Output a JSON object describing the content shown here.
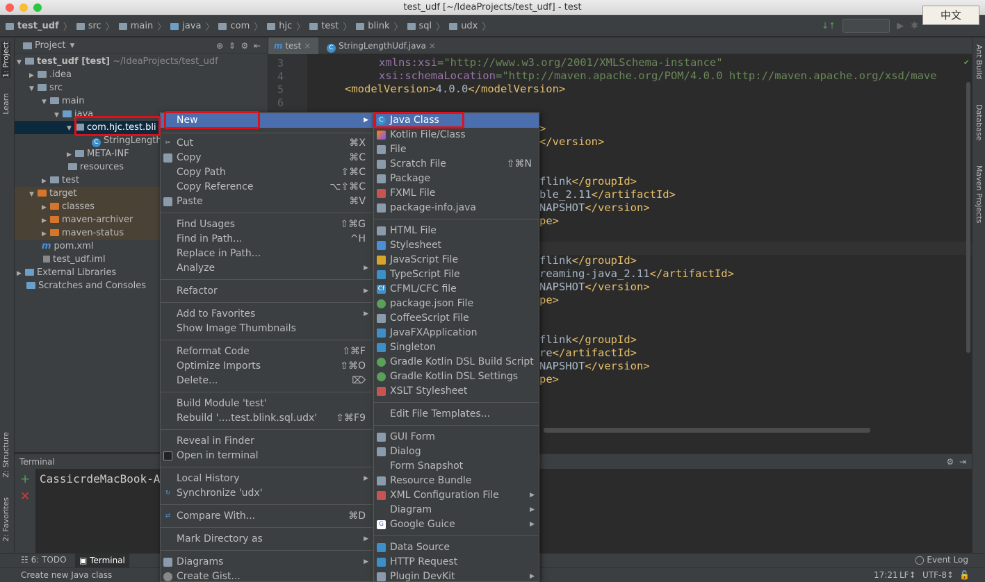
{
  "window": {
    "title": "test_udf [~/IdeaProjects/test_udf] - test",
    "ime_label": "中文"
  },
  "breadcrumbs": [
    "test_udf",
    "src",
    "main",
    "java",
    "com",
    "hjc",
    "test",
    "blink",
    "sql",
    "udx"
  ],
  "left_tabs": {
    "project": "1: Project",
    "learn": "Learn",
    "structure": "Z: Structure",
    "favorites": "2: Favorites"
  },
  "right_tabs": {
    "ant": "Ant Build",
    "database": "Database",
    "maven": "Maven Projects"
  },
  "project_panel": {
    "title": "Project",
    "tree": [
      {
        "label": "test_udf [test]",
        "suffix": "~/IdeaProjects/test_udf"
      },
      {
        "label": ".idea"
      },
      {
        "label": "src"
      },
      {
        "label": "main"
      },
      {
        "label": "java"
      },
      {
        "label": "com.hjc.test.bli"
      },
      {
        "label": "StringLength"
      },
      {
        "label": "META-INF"
      },
      {
        "label": "resources"
      },
      {
        "label": "test"
      },
      {
        "label": "target"
      },
      {
        "label": "classes"
      },
      {
        "label": "maven-archiver"
      },
      {
        "label": "maven-status"
      },
      {
        "label": "pom.xml"
      },
      {
        "label": "test_udf.iml"
      },
      {
        "label": "External Libraries"
      },
      {
        "label": "Scratches and Consoles"
      }
    ]
  },
  "editor": {
    "tabs": [
      {
        "label": "test"
      },
      {
        "label": "StringLengthUdf.java"
      }
    ],
    "line_numbers": [
      "3",
      "4",
      "5",
      "6"
    ],
    "lines": {
      "l3a": "xmlns",
      "l3b": ":xsi",
      "l3c": "=\"http://www.w3.org/2001/XMLSchema-instance\"",
      "l4a": "xsi:schemaLocation",
      "l4b": "=\"http://maven.apache.org/POM/4.0.0 http://maven.apache.org/xsd/mave",
      "l5a": "<modelVersion>",
      "l5b": "4.0.0",
      "l5c": "</modelVersion>",
      "r1": ">",
      "r2": "</version>",
      "r3a": "flink",
      "r3b": "</groupId>",
      "r4a": "ble_2.11",
      "r4b": "</artifactId>",
      "r5a": "NAPSHOT",
      "r5b": "</version>",
      "r6": "pe>",
      "r7a": "flink",
      "r7b": "</groupId>",
      "r8a": "reaming-java_2.11",
      "r8b": "</artifactId>",
      "r9a": "NAPSHOT",
      "r9b": "</version>",
      "r10": "pe>",
      "r11a": "flink",
      "r11b": "</groupId>",
      "r12a": "re",
      "r12b": "</artifactId>",
      "r13a": "NAPSHOT",
      "r13b": "</version>",
      "r14": "pe>"
    }
  },
  "terminal": {
    "title": "Terminal",
    "prompt": "CassicrdeMacBook-A"
  },
  "bottom_tabs": {
    "todo": "6: TODO",
    "terminal": "Terminal",
    "event_log": "Event Log"
  },
  "status": {
    "message": "Create new Java class",
    "position": "17:21",
    "line_sep": "LF↕",
    "encoding": "UTF-8↕"
  },
  "context_menu": {
    "items": [
      {
        "label": "New",
        "shortcut": ""
      },
      {
        "label": "Cut",
        "shortcut": "⌘X"
      },
      {
        "label": "Copy",
        "shortcut": "⌘C"
      },
      {
        "label": "Copy Path",
        "shortcut": "⇧⌘C"
      },
      {
        "label": "Copy Reference",
        "shortcut": "⌥⇧⌘C"
      },
      {
        "label": "Paste",
        "shortcut": "⌘V"
      },
      {
        "label": "Find Usages",
        "shortcut": "⇧⌘G"
      },
      {
        "label": "Find in Path...",
        "shortcut": "^H"
      },
      {
        "label": "Replace in Path...",
        "shortcut": ""
      },
      {
        "label": "Analyze",
        "shortcut": ""
      },
      {
        "label": "Refactor",
        "shortcut": ""
      },
      {
        "label": "Add to Favorites",
        "shortcut": ""
      },
      {
        "label": "Show Image Thumbnails",
        "shortcut": ""
      },
      {
        "label": "Reformat Code",
        "shortcut": "⇧⌘F"
      },
      {
        "label": "Optimize Imports",
        "shortcut": "⇧⌘O"
      },
      {
        "label": "Delete...",
        "shortcut": "⌦"
      },
      {
        "label": "Build Module 'test'",
        "shortcut": ""
      },
      {
        "label": "Rebuild '....test.blink.sql.udx'",
        "shortcut": "⇧⌘F9"
      },
      {
        "label": "Reveal in Finder",
        "shortcut": ""
      },
      {
        "label": "Open in terminal",
        "shortcut": ""
      },
      {
        "label": "Local History",
        "shortcut": ""
      },
      {
        "label": "Synchronize 'udx'",
        "shortcut": ""
      },
      {
        "label": "Compare With...",
        "shortcut": "⌘D"
      },
      {
        "label": "Mark Directory as",
        "shortcut": ""
      },
      {
        "label": "Diagrams",
        "shortcut": ""
      },
      {
        "label": "Create Gist...",
        "shortcut": ""
      }
    ]
  },
  "new_submenu": {
    "items": [
      {
        "label": "Java Class",
        "shortcut": ""
      },
      {
        "label": "Kotlin File/Class",
        "shortcut": ""
      },
      {
        "label": "File",
        "shortcut": ""
      },
      {
        "label": "Scratch File",
        "shortcut": "⇧⌘N"
      },
      {
        "label": "Package",
        "shortcut": ""
      },
      {
        "label": "FXML File",
        "shortcut": ""
      },
      {
        "label": "package-info.java",
        "shortcut": ""
      },
      {
        "label": "HTML File",
        "shortcut": ""
      },
      {
        "label": "Stylesheet",
        "shortcut": ""
      },
      {
        "label": "JavaScript File",
        "shortcut": ""
      },
      {
        "label": "TypeScript File",
        "shortcut": ""
      },
      {
        "label": "CFML/CFC file",
        "shortcut": ""
      },
      {
        "label": "package.json File",
        "shortcut": ""
      },
      {
        "label": "CoffeeScript File",
        "shortcut": ""
      },
      {
        "label": "JavaFXApplication",
        "shortcut": ""
      },
      {
        "label": "Singleton",
        "shortcut": ""
      },
      {
        "label": "Gradle Kotlin DSL Build Script",
        "shortcut": ""
      },
      {
        "label": "Gradle Kotlin DSL Settings",
        "shortcut": ""
      },
      {
        "label": "XSLT Stylesheet",
        "shortcut": ""
      },
      {
        "label": "Edit File Templates...",
        "shortcut": ""
      },
      {
        "label": "GUI Form",
        "shortcut": ""
      },
      {
        "label": "Dialog",
        "shortcut": ""
      },
      {
        "label": "Form Snapshot",
        "shortcut": ""
      },
      {
        "label": "Resource Bundle",
        "shortcut": ""
      },
      {
        "label": "XML Configuration File",
        "shortcut": ""
      },
      {
        "label": "Diagram",
        "shortcut": ""
      },
      {
        "label": "Google Guice",
        "shortcut": ""
      },
      {
        "label": "Data Source",
        "shortcut": ""
      },
      {
        "label": "HTTP Request",
        "shortcut": ""
      },
      {
        "label": "Plugin DevKit",
        "shortcut": ""
      }
    ]
  },
  "colors": {
    "selection": "#4b6eaf",
    "highlight_box": "#e01018",
    "panel_bg": "#3c3f41",
    "editor_bg": "#2b2b2b"
  }
}
